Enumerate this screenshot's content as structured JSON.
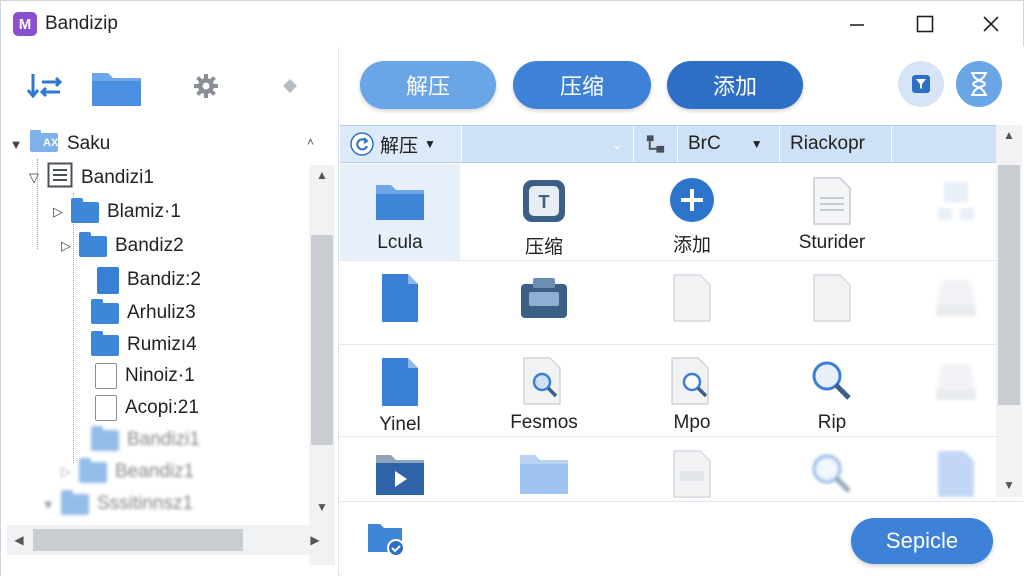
{
  "window": {
    "title": "Bandizip",
    "logo_letter": "M",
    "controls": {
      "minimize": "—",
      "maximize": "☐",
      "close": "✕"
    }
  },
  "left_toolbar": {
    "icons": [
      "sync-icon",
      "folder-icon",
      "gear-icon",
      "diamond-icon"
    ]
  },
  "tree": {
    "root": {
      "badge": "AX",
      "label": "Saku"
    },
    "items": [
      {
        "label": "Bandizi1",
        "type": "archive"
      },
      {
        "label": "Blamiz·1",
        "type": "folder"
      },
      {
        "label": "Bandiz2",
        "type": "folder"
      },
      {
        "label": "Bandiz:2",
        "type": "blue-doc"
      },
      {
        "label": "Arhuliz3",
        "type": "folder"
      },
      {
        "label": "Rumizı4",
        "type": "folder"
      },
      {
        "label": "Ninoiz·1",
        "type": "doc"
      },
      {
        "label": "Acopi:21",
        "type": "doc"
      },
      {
        "label": "Bandizi1",
        "type": "folder-faded"
      },
      {
        "label": "Beandiz1",
        "type": "folder-faded"
      },
      {
        "label": "Sssitinnsz1",
        "type": "folder-faded"
      }
    ]
  },
  "toolbar": {
    "extract_label": "解压",
    "compress_label": "压缩",
    "add_label": "添加",
    "colors": {
      "pill_light": "#6aa5e6",
      "pill_mid": "#3d82d6",
      "pill_dark": "#2d6fc4"
    }
  },
  "pathbar": {
    "dropdown_label": "解压",
    "segment_label": "BrC",
    "right_label": "Riackopr"
  },
  "files": [
    {
      "label": "Lcula",
      "icon": "folder-icon"
    },
    {
      "label": "压缩",
      "icon": "archive-icon"
    },
    {
      "label": "添加",
      "icon": "plus-circle-icon"
    },
    {
      "label": "Sturider",
      "icon": "document-icon"
    },
    {
      "label": "",
      "icon": "faded-network-icon"
    },
    {
      "label": "",
      "icon": "blue-file-icon"
    },
    {
      "label": "",
      "icon": "briefcase-icon"
    },
    {
      "label": "",
      "icon": "faded-file-icon"
    },
    {
      "label": "",
      "icon": "faded-file-icon"
    },
    {
      "label": "",
      "icon": "faded-drive-icon"
    },
    {
      "label": "Yinel",
      "icon": "blue-file-icon"
    },
    {
      "label": "Fesmos",
      "icon": "search-file-icon"
    },
    {
      "label": "Mpo",
      "icon": "search-file-icon"
    },
    {
      "label": "Rip",
      "icon": "magnifier-icon"
    },
    {
      "label": "",
      "icon": "faded-drive-icon"
    },
    {
      "label": "",
      "icon": "video-folder-icon"
    },
    {
      "label": "",
      "icon": "faded-folder-icon"
    },
    {
      "label": "",
      "icon": "faded-file-icon"
    },
    {
      "label": "",
      "icon": "faded-magnifier-icon"
    },
    {
      "label": "",
      "icon": "faded-blue-file-icon"
    }
  ],
  "footer": {
    "select_label": "Sepicle"
  }
}
